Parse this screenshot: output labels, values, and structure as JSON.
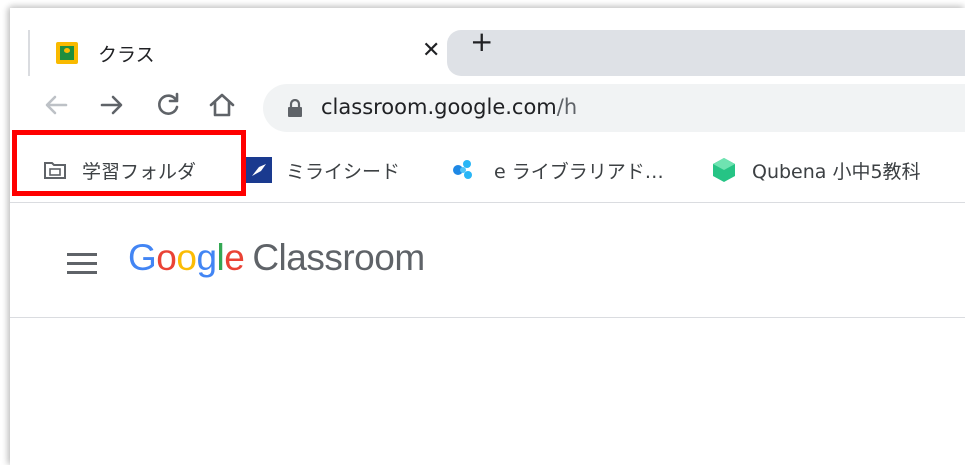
{
  "tab": {
    "title": "クラス",
    "close": "✕",
    "new_tab": "+"
  },
  "address": {
    "domain": "classroom.google.com",
    "path": "/h"
  },
  "bookmarks": [
    {
      "label": "学習フォルダ",
      "icon": "folder-icon"
    },
    {
      "label": "ミライシード",
      "icon": "miraiseed-icon"
    },
    {
      "label": "e ライブラリアド…",
      "icon": "elibrary-icon"
    },
    {
      "label": "Qubena 小中5教科",
      "icon": "qubena-icon"
    }
  ],
  "app": {
    "logo_letters": [
      "G",
      "o",
      "o",
      "g",
      "l",
      "e"
    ],
    "product": "Classroom"
  },
  "colors": {
    "highlight": "#ff0000",
    "tab_inactive": "#dee1e6",
    "omnibox": "#f1f3f4"
  }
}
